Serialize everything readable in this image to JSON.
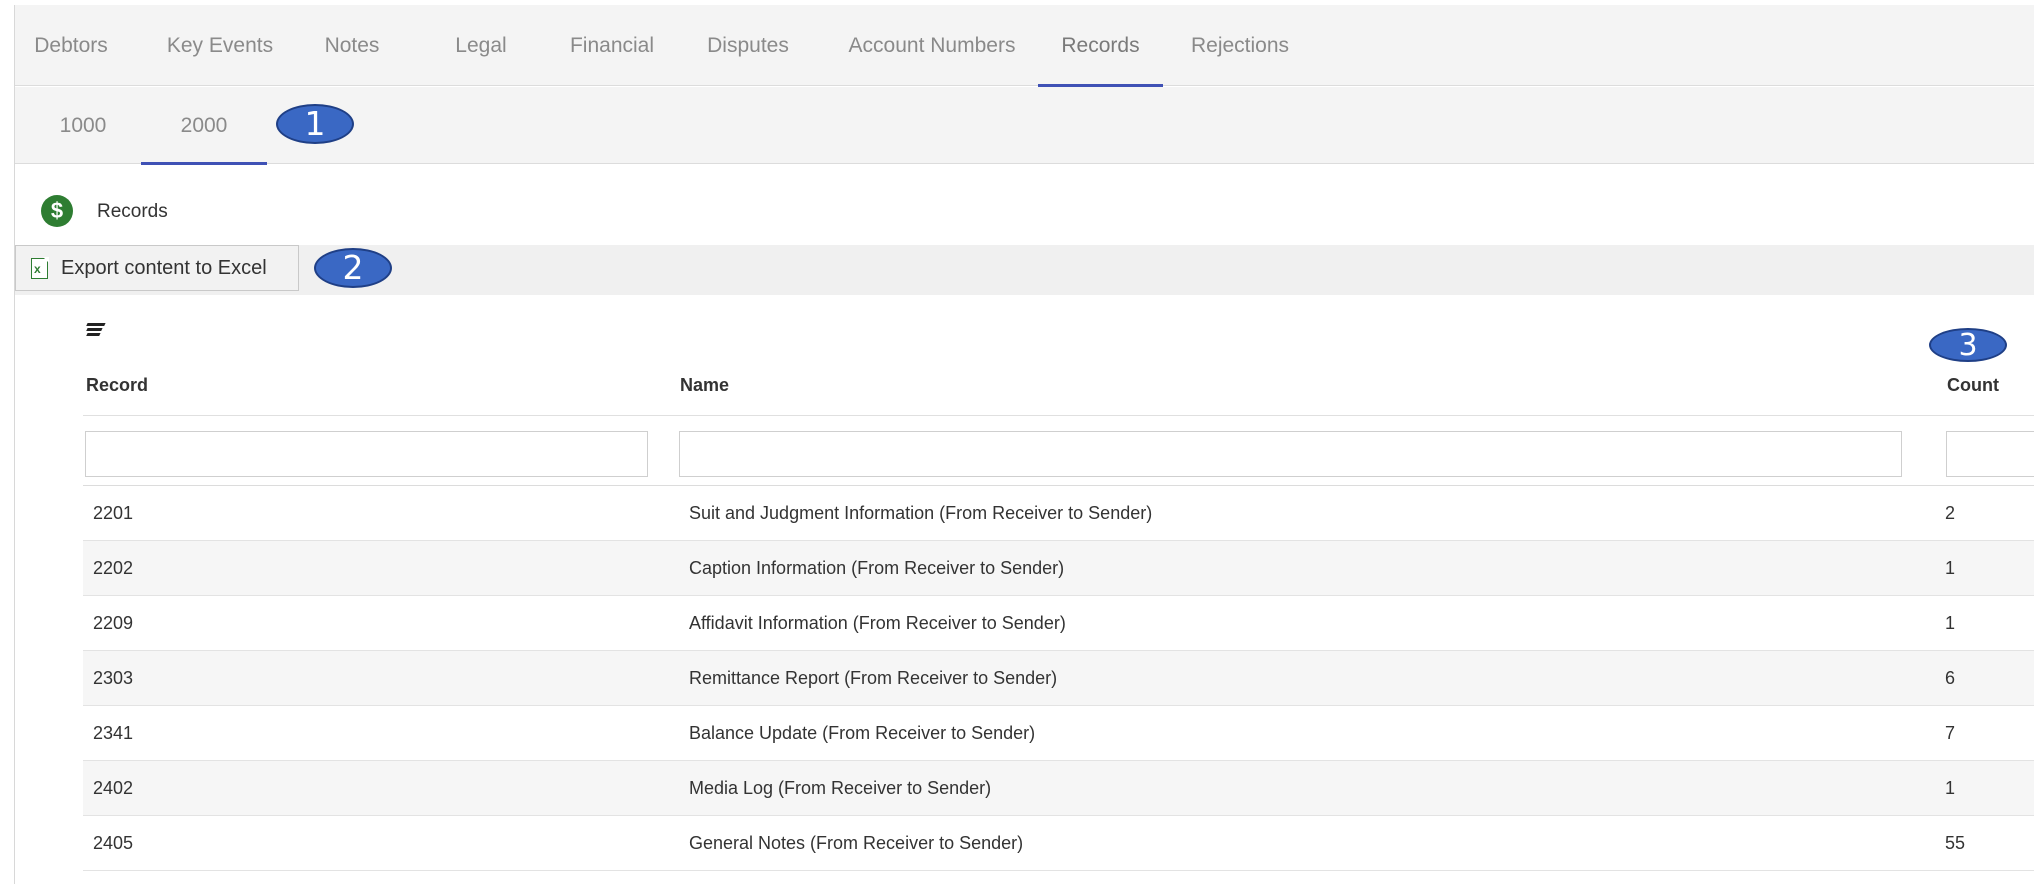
{
  "top_tabs": [
    {
      "label": "Debtors"
    },
    {
      "label": "Key Events"
    },
    {
      "label": "Notes"
    },
    {
      "label": "Legal"
    },
    {
      "label": "Financial"
    },
    {
      "label": "Disputes"
    },
    {
      "label": "Account Numbers"
    },
    {
      "label": "Records",
      "active": true
    },
    {
      "label": "Rejections"
    }
  ],
  "sub_tabs": [
    {
      "label": "1000"
    },
    {
      "label": "2000",
      "active": true
    }
  ],
  "callouts": [
    "1",
    "2",
    "3"
  ],
  "section": {
    "title": "Records",
    "icon": "dollar-circle-icon"
  },
  "toolbar": {
    "export_label": "Export content to Excel",
    "icon": "excel-file-icon"
  },
  "table": {
    "columns": [
      "Record",
      "Name",
      "Count"
    ],
    "rows": [
      {
        "record": "2201",
        "name": "Suit and Judgment Information (From Receiver to Sender)",
        "count": "2"
      },
      {
        "record": "2202",
        "name": "Caption Information (From Receiver to Sender)",
        "count": "1"
      },
      {
        "record": "2209",
        "name": "Affidavit Information (From Receiver to Sender)",
        "count": "1"
      },
      {
        "record": "2303",
        "name": "Remittance Report (From Receiver to Sender)",
        "count": "6"
      },
      {
        "record": "2341",
        "name": "Balance Update (From Receiver to Sender)",
        "count": "7"
      },
      {
        "record": "2402",
        "name": "Media Log (From Receiver to Sender)",
        "count": "1"
      },
      {
        "record": "2405",
        "name": "General Notes (From Receiver to Sender)",
        "count": "55"
      }
    ]
  },
  "colors": {
    "accent": "#3f51b5",
    "callout": "#3a68c4",
    "icon_green": "#2e7d32"
  }
}
